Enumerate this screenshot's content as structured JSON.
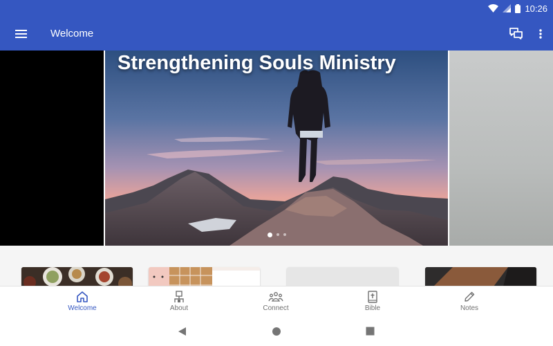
{
  "status": {
    "time": "10:26"
  },
  "app_bar": {
    "title": "Welcome"
  },
  "carousel": {
    "slide_title": "Strengthening Souls Ministry",
    "slide_count": 3,
    "active_slide": 1
  },
  "bottom_nav": {
    "items": [
      {
        "label": "Welcome",
        "icon": "home-icon",
        "active": true
      },
      {
        "label": "About",
        "icon": "about-icon",
        "active": false
      },
      {
        "label": "Connect",
        "icon": "people-icon",
        "active": false
      },
      {
        "label": "Bible",
        "icon": "bible-icon",
        "active": false
      },
      {
        "label": "Notes",
        "icon": "pencil-icon",
        "active": false
      }
    ]
  },
  "colors": {
    "primary": "#3557c1",
    "nav_inactive": "#707070"
  }
}
